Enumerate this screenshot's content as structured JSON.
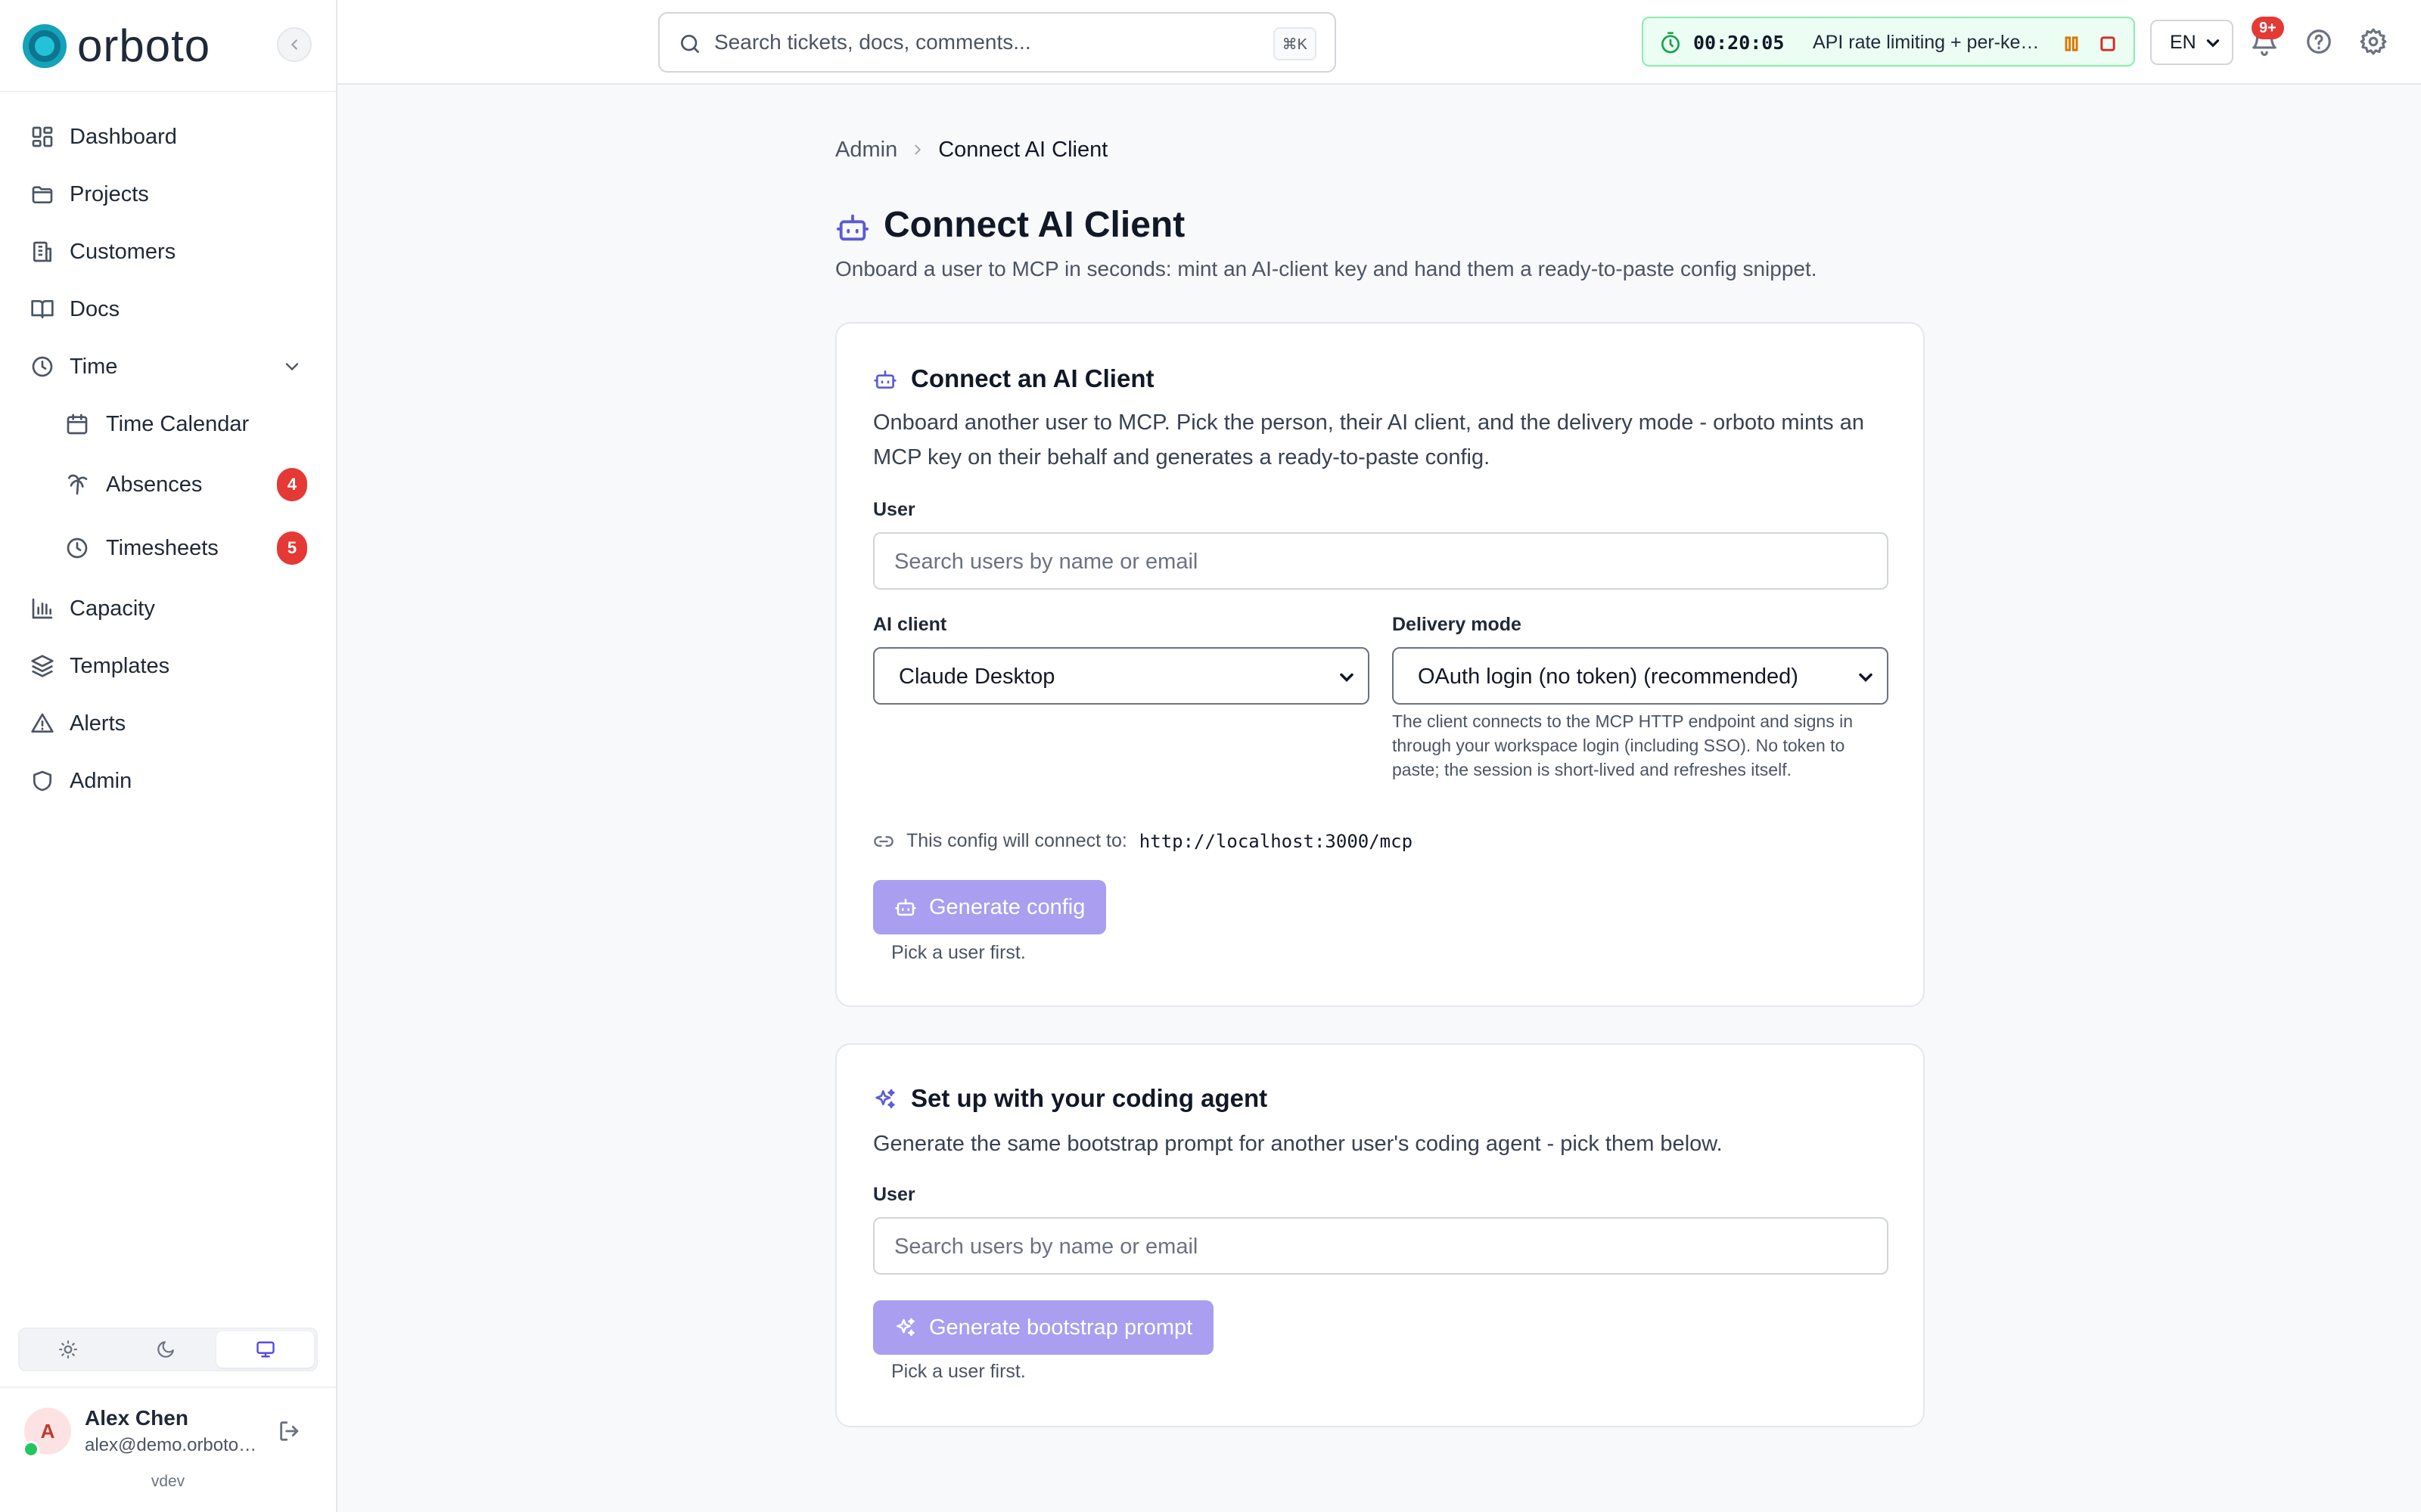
{
  "brand": {
    "name": "orboto"
  },
  "sidebar": {
    "items": [
      {
        "label": "Dashboard",
        "icon": "dashboard-icon"
      },
      {
        "label": "Projects",
        "icon": "folder-icon"
      },
      {
        "label": "Customers",
        "icon": "building-icon"
      },
      {
        "label": "Docs",
        "icon": "book-icon"
      },
      {
        "label": "Time",
        "icon": "clock-icon",
        "expanded": true,
        "children": [
          {
            "label": "Time Calendar",
            "icon": "calendar-icon"
          },
          {
            "label": "Absences",
            "icon": "palm-tree-icon",
            "badge": "4"
          },
          {
            "label": "Timesheets",
            "icon": "clock-icon",
            "badge": "5"
          }
        ]
      },
      {
        "label": "Capacity",
        "icon": "bar-chart-icon"
      },
      {
        "label": "Templates",
        "icon": "layers-icon"
      },
      {
        "label": "Alerts",
        "icon": "alert-triangle-icon"
      },
      {
        "label": "Admin",
        "icon": "shield-icon"
      }
    ],
    "theme_options": [
      "light",
      "dark",
      "system"
    ],
    "theme_selected": "system"
  },
  "user": {
    "initial": "A",
    "name": "Alex Chen",
    "email": "alex@demo.orboto.io",
    "version": "vdev"
  },
  "topbar": {
    "search_placeholder": "Search tickets, docs, comments...",
    "search_shortcut": "⌘K",
    "timer": {
      "time": "00:20:05",
      "task": "API rate limiting + per-key quotas"
    },
    "language": "EN",
    "notifications_badge": "9+"
  },
  "breadcrumb": {
    "root": "Admin",
    "current": "Connect AI Client"
  },
  "page": {
    "title": "Connect AI Client",
    "subtitle": "Onboard a user to MCP in seconds: mint an AI-client key and hand them a ready-to-paste config snippet."
  },
  "connect_card": {
    "title": "Connect an AI Client",
    "description": "Onboard another user to MCP. Pick the person, their AI client, and the delivery mode - orboto mints an MCP key on their behalf and generates a ready-to-paste config.",
    "user_label": "User",
    "user_placeholder": "Search users by name or email",
    "client_label": "AI client",
    "client_value": "Claude Desktop",
    "delivery_label": "Delivery mode",
    "delivery_value": "OAuth login (no token) (recommended)",
    "delivery_help": "The client connects to the MCP HTTP endpoint and signs in through your workspace login (including SSO). No token to paste; the session is short-lived and refreshes itself.",
    "connect_label": "This config will connect to:",
    "connect_url": "http://localhost:3000/mcp",
    "button_label": "Generate config",
    "hint": "Pick a user first."
  },
  "agent_card": {
    "title": "Set up with your coding agent",
    "description": "Generate the same bootstrap prompt for another user's coding agent - pick them below.",
    "user_label": "User",
    "user_placeholder": "Search users by name or email",
    "button_label": "Generate bootstrap prompt",
    "hint": "Pick a user first."
  },
  "colors": {
    "accent": "#5b5bd6",
    "button_disabled": "#a99ef0",
    "brand": "#14a3b8",
    "badge": "#e53935"
  }
}
